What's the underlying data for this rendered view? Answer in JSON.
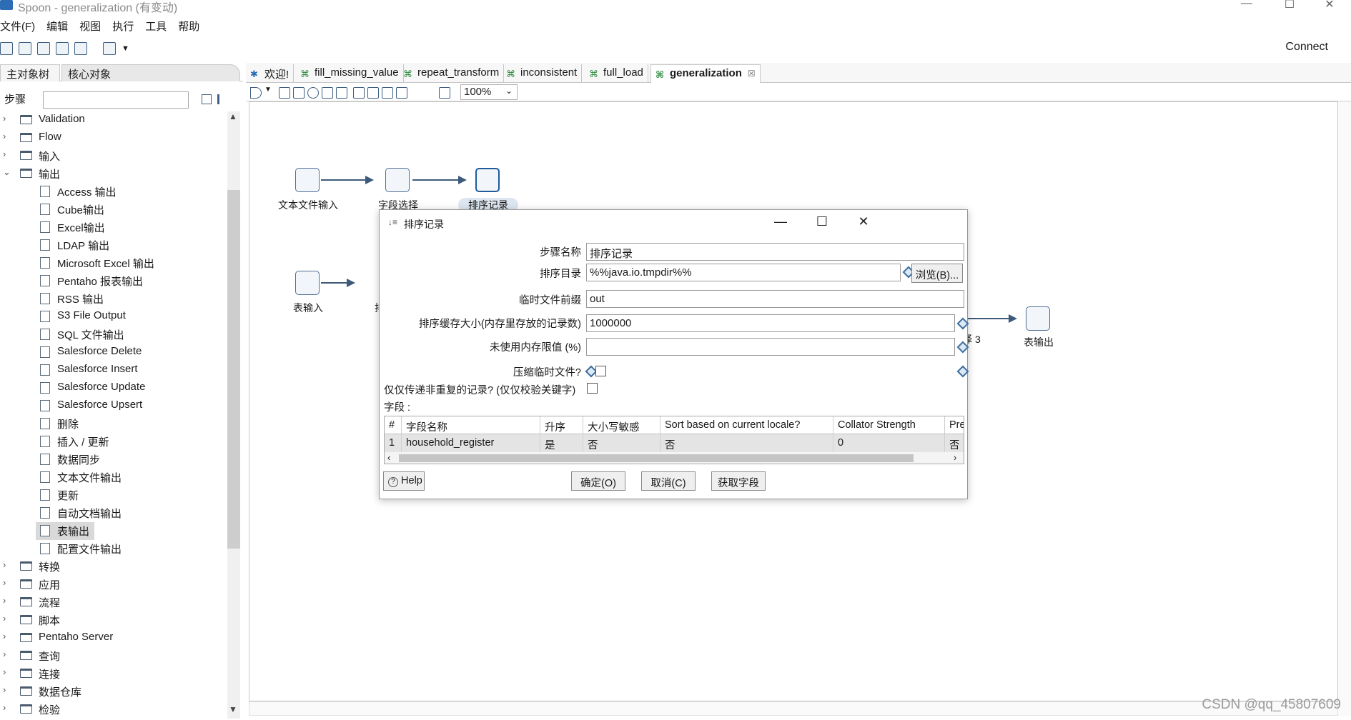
{
  "window": {
    "title": "Spoon - generalization (有变动)",
    "minimize": "—",
    "maximize": "☐",
    "close": "✕"
  },
  "menu": [
    "文件(F)",
    "编辑",
    "视图",
    "执行",
    "工具",
    "帮助"
  ],
  "toolbar": {
    "connect": "Connect"
  },
  "left_panel": {
    "tabs": [
      "主对象树",
      "核心对象"
    ],
    "steps_label": "步骤",
    "search_value": "",
    "tree": [
      {
        "label": "Validation",
        "type": "folder",
        "expanded": false
      },
      {
        "label": "Flow",
        "type": "folder",
        "expanded": false
      },
      {
        "label": "输入",
        "type": "folder",
        "expanded": false
      },
      {
        "label": "输出",
        "type": "folder",
        "expanded": true
      },
      {
        "label": "Access 输出",
        "type": "leaf"
      },
      {
        "label": "Cube输出",
        "type": "leaf"
      },
      {
        "label": "Excel输出",
        "type": "leaf"
      },
      {
        "label": "LDAP 输出",
        "type": "leaf"
      },
      {
        "label": "Microsoft Excel 输出",
        "type": "leaf"
      },
      {
        "label": "Pentaho 报表输出",
        "type": "leaf"
      },
      {
        "label": "RSS 输出",
        "type": "leaf"
      },
      {
        "label": "S3 File Output",
        "type": "leaf"
      },
      {
        "label": "SQL 文件输出",
        "type": "leaf"
      },
      {
        "label": "Salesforce Delete",
        "type": "leaf"
      },
      {
        "label": "Salesforce Insert",
        "type": "leaf"
      },
      {
        "label": "Salesforce Update",
        "type": "leaf"
      },
      {
        "label": "Salesforce Upsert",
        "type": "leaf"
      },
      {
        "label": "删除",
        "type": "leaf"
      },
      {
        "label": "插入 / 更新",
        "type": "leaf"
      },
      {
        "label": "数据同步",
        "type": "leaf"
      },
      {
        "label": "文本文件输出",
        "type": "leaf"
      },
      {
        "label": "更新",
        "type": "leaf"
      },
      {
        "label": "自动文档输出",
        "type": "leaf"
      },
      {
        "label": "表输出",
        "type": "leaf",
        "selected": true
      },
      {
        "label": "配置文件输出",
        "type": "leaf"
      },
      {
        "label": "转换",
        "type": "folder",
        "expanded": false
      },
      {
        "label": "应用",
        "type": "folder",
        "expanded": false
      },
      {
        "label": "流程",
        "type": "folder",
        "expanded": false
      },
      {
        "label": "脚本",
        "type": "folder",
        "expanded": false
      },
      {
        "label": "Pentaho Server",
        "type": "folder",
        "expanded": false
      },
      {
        "label": "查询",
        "type": "folder",
        "expanded": false
      },
      {
        "label": "连接",
        "type": "folder",
        "expanded": false
      },
      {
        "label": "数据仓库",
        "type": "folder",
        "expanded": false
      },
      {
        "label": "检验",
        "type": "folder",
        "expanded": false
      }
    ]
  },
  "editor": {
    "tabs": [
      {
        "label": "欢迎!",
        "active": false
      },
      {
        "label": "fill_missing_value",
        "active": false
      },
      {
        "label": "repeat_transform",
        "active": false
      },
      {
        "label": "inconsistent",
        "active": false
      },
      {
        "label": "full_load",
        "active": false
      },
      {
        "label": "generalization",
        "active": true,
        "close": "☒"
      }
    ],
    "zoom": "100%",
    "steps": {
      "text_input": "文本文件输入",
      "field_select": "字段选择",
      "sort": "排序记录",
      "table_input": "表输入",
      "partial_left": "排",
      "partial_right": "择 3",
      "table_output": "表输出"
    }
  },
  "dialog": {
    "title": "排序记录",
    "fields": {
      "step_name_label": "步骤名称",
      "step_name_value": "排序记录",
      "sort_dir_label": "排序目录",
      "sort_dir_value": "%%java.io.tmpdir%%",
      "browse_button": "浏览(B)...",
      "temp_prefix_label": "临时文件前缀",
      "temp_prefix_value": "out",
      "sort_size_label": "排序缓存大小(内存里存放的记录数)",
      "sort_size_value": "1000000",
      "free_mem_label": "未使用内存限值 (%)",
      "free_mem_value": "",
      "compress_label": "压缩临时文件?",
      "unique_label": "仅仅传递非重复的记录? (仅仅校验关键字)",
      "fields_label": "字段 :"
    },
    "table": {
      "headers": [
        "#",
        "字段名称",
        "升序",
        "大小写敏感",
        "Sort based on current locale?",
        "Collator Strength",
        "Preso"
      ],
      "rows": [
        [
          "1",
          "household_register",
          "是",
          "否",
          "否",
          "0",
          "否"
        ]
      ]
    },
    "buttons": {
      "help": "Help",
      "ok": "确定(O)",
      "cancel": "取消(C)",
      "get_fields": "获取字段"
    }
  },
  "watermark": "CSDN @qq_45807609"
}
